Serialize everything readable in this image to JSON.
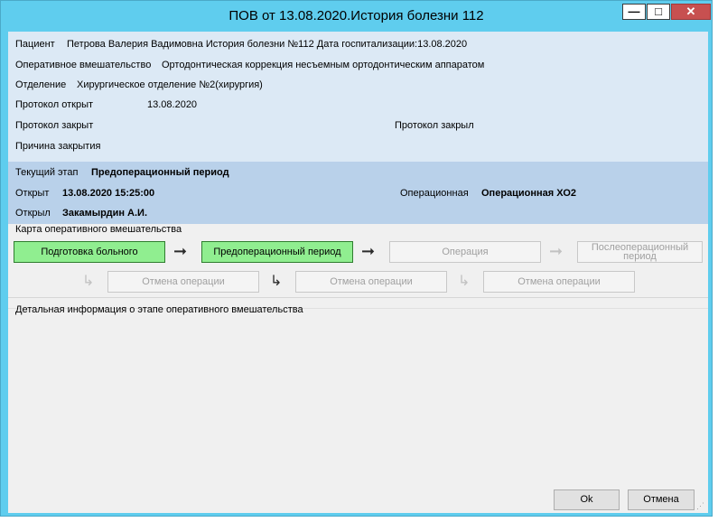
{
  "window": {
    "title": "ПОВ от 13.08.2020.История болезни 112",
    "minimize_glyph": "—",
    "maximize_glyph": "□",
    "close_glyph": "✕"
  },
  "info": {
    "patient_label": "Пациент",
    "patient_value": "Петрова Валерия Вадимовна История болезни №112 Дата госпитализации:13.08.2020",
    "operation_label": "Оперативное вмешательство",
    "operation_value": "Ортодонтическая коррекция несъемным ортодонтическим аппаратом",
    "department_label": "Отделение",
    "department_value": "Хирургическое отделение №2(хирургия)",
    "protocol_opened_label": "Протокол открыт",
    "protocol_opened_value": "13.08.2020",
    "protocol_closed_label": "Протокол закрыт",
    "protocol_closed_by_label": "Протокол закрыл",
    "close_reason_label": "Причина закрытия"
  },
  "stage": {
    "current_label": "Текущий этап",
    "current_value": "Предоперационный период",
    "opened_label": "Открыт",
    "opened_value": "13.08.2020 15:25:00",
    "operating_room_label": "Операционная",
    "operating_room_value": "Операционная ХО2",
    "opened_by_label": "Открыл",
    "opened_by_value": "Закамырдин А.И."
  },
  "map": {
    "label": "Карта оперативного вмешательства",
    "steps": [
      {
        "label": "Подготовка больного",
        "status": "done"
      },
      {
        "label": "Предоперационный период",
        "status": "done"
      },
      {
        "label": "Операция",
        "status": "disabled"
      },
      {
        "label": "Послеоперационный период",
        "status": "disabled"
      }
    ],
    "cancel_buttons": [
      "Отмена операции",
      "Отмена операции",
      "Отмена операции"
    ],
    "arrow_glyph": "➞",
    "hook_glyph": "↳"
  },
  "detail": {
    "label": "Детальная информация о этапе оперативного вмешательства"
  },
  "buttons": {
    "ok": "Ok",
    "cancel": "Отмена"
  },
  "colors": {
    "titlebar": "#5fcdee",
    "info_bg": "#dce9f5",
    "stage_bg": "#b9d1ea",
    "done_step": "#90ee90"
  }
}
